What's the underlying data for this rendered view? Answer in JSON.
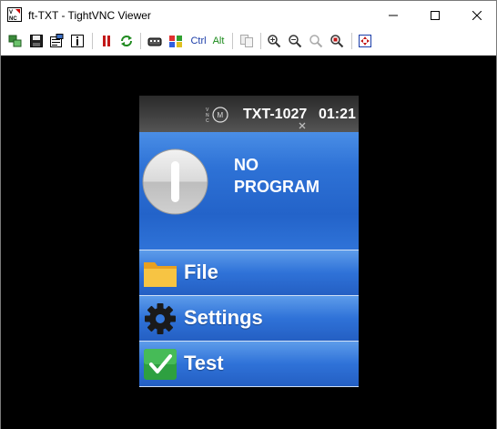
{
  "window": {
    "title": "ft-TXT - TightVNC Viewer",
    "icon": "tightvnc-app-icon",
    "controls": [
      "minimize-icon",
      "maximize-icon",
      "close-icon"
    ]
  },
  "toolbar": {
    "buttons": [
      {
        "name": "new-connection-icon"
      },
      {
        "name": "save-icon"
      },
      {
        "name": "options-icon"
      },
      {
        "name": "connection-info-icon"
      },
      {
        "name": "pause-icon"
      },
      {
        "name": "refresh-icon"
      },
      {
        "name": "ctrl-alt-del-icon"
      },
      {
        "name": "ctrl-esc-icon"
      },
      {
        "name": "ctrl-key",
        "label": "Ctrl"
      },
      {
        "name": "alt-key",
        "label": "Alt"
      },
      {
        "name": "transfer-files-icon"
      },
      {
        "name": "zoom-in-icon"
      },
      {
        "name": "zoom-out-icon"
      },
      {
        "name": "zoom-100-icon"
      },
      {
        "name": "zoom-fit-icon"
      },
      {
        "name": "fullscreen-icon"
      }
    ]
  },
  "txt": {
    "status": {
      "vnc_icon": "vnc-status-icon",
      "device_name": "TXT-1027",
      "time": "01:21"
    },
    "program": {
      "stop_icon": "stop-button-icon",
      "label": "NO\nPROGRAM"
    },
    "menu": [
      {
        "label": "File",
        "icon": "folder-icon"
      },
      {
        "label": "Settings",
        "icon": "gear-icon"
      },
      {
        "label": "Test",
        "icon": "checkmark-icon"
      }
    ]
  },
  "colors": {
    "panel_blue": "#2e72d6",
    "status_dark": "#2a2a2a",
    "viewer_bg": "#000000"
  }
}
